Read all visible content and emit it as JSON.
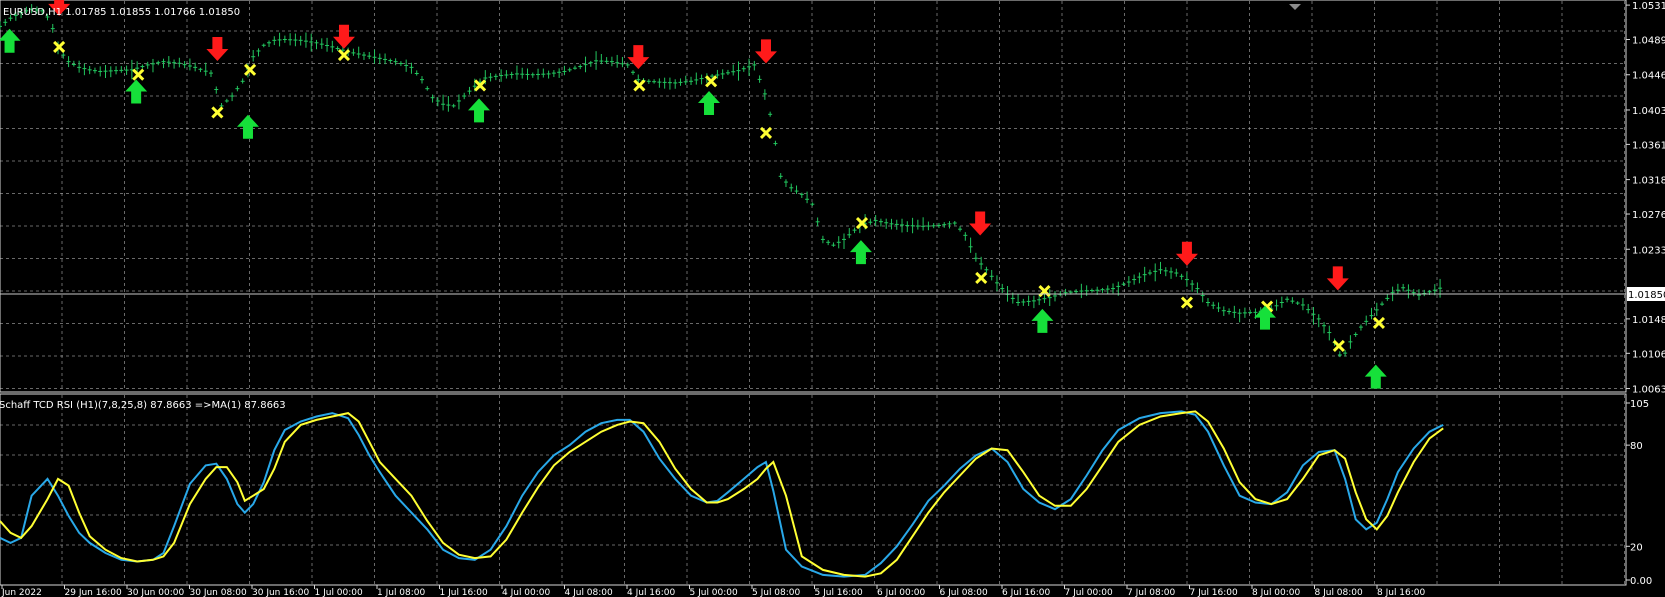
{
  "colors": {
    "background": "#000000",
    "grid": "#c0c0c0",
    "frame": "#d8d8d8",
    "candles": "#22c55e",
    "buy_arrow": "#16e03a",
    "sell_arrow": "#ff1a1a",
    "cross": "#ffff33",
    "schaff_line": "#29a8e8",
    "signal_line": "#ffff33",
    "text": "#ffffff",
    "price_label_bg": "#ffffff",
    "price_label_text": "#000000"
  },
  "main_panel": {
    "title": "EURUSD,H1  1.01785 1.01855 1.01766 1.01850",
    "price_axis": [
      "1.05310",
      "1.04890",
      "1.04460",
      "1.04030",
      "1.03610",
      "1.03180",
      "1.02760",
      "1.02330",
      "1.01850",
      "1.01480",
      "1.01060",
      "1.00630"
    ],
    "current_price": "1.01850"
  },
  "indicator_panel": {
    "title": "Schaff TCD RSI (H1)(7,8,25,8) 87.8663  =>MA(1) 87.8663",
    "axis_labels": [
      "105",
      "80",
      "20",
      "0.00"
    ]
  },
  "time_axis": [
    "Jun 2022",
    "29 Jun 16:00",
    "30 Jun 00:00",
    "30 Jun 08:00",
    "30 Jun 16:00",
    "1 Jul 00:00",
    "1 Jul 08:00",
    "1 Jul 16:00",
    "4 Jul 00:00",
    "4 Jul 08:00",
    "4 Jul 16:00",
    "5 Jul 00:00",
    "5 Jul 08:00",
    "5 Jul 16:00",
    "6 Jul 00:00",
    "6 Jul 08:00",
    "6 Jul 16:00",
    "7 Jul 00:00",
    "7 Jul 08:00",
    "7 Jul 16:00",
    "8 Jul 00:00",
    "8 Jul 08:00",
    "8 Jul 16:00"
  ],
  "chart_data": {
    "type": "line",
    "title": "EURUSD,H1",
    "price_series": {
      "name": "EURUSD,H1",
      "x": [
        0,
        10,
        20,
        30,
        40,
        48,
        55,
        65,
        75,
        85,
        95,
        110,
        125,
        140,
        155,
        170,
        185,
        200,
        210,
        220,
        230,
        240,
        250,
        260,
        270,
        285,
        300,
        315,
        330,
        345,
        360,
        375,
        390,
        400,
        410,
        420,
        430,
        440,
        450,
        460,
        475,
        490,
        505,
        520,
        535,
        550,
        565,
        580,
        595,
        605,
        615,
        625,
        640,
        655,
        670,
        685,
        700,
        715,
        728,
        735,
        740,
        750,
        760,
        770,
        780,
        790,
        800,
        815,
        830,
        845,
        860,
        875,
        890,
        905,
        915,
        925,
        935,
        945,
        955,
        965,
        980,
        995,
        1010,
        1025,
        1040,
        1055,
        1070,
        1085,
        1100,
        1115,
        1125,
        1135,
        1145,
        1160,
        1175,
        1190,
        1205,
        1220,
        1235,
        1250,
        1262,
        1272,
        1280,
        1290,
        1300,
        1310,
        1320,
        1330,
        1345,
        1360,
        1368
      ],
      "y": [
        1.0505,
        1.0515,
        1.0522,
        1.0526,
        1.0524,
        1.0512,
        1.0478,
        1.0462,
        1.0455,
        1.0452,
        1.045,
        1.0451,
        1.0452,
        1.0458,
        1.0462,
        1.046,
        1.0455,
        1.0448,
        1.0408,
        1.042,
        1.0438,
        1.0468,
        1.0482,
        1.0488,
        1.0489,
        1.0488,
        1.0485,
        1.048,
        1.0474,
        1.047,
        1.0466,
        1.0462,
        1.0455,
        1.044,
        1.0418,
        1.041,
        1.0408,
        1.042,
        1.0432,
        1.0442,
        1.0445,
        1.0447,
        1.0446,
        1.0447,
        1.045,
        1.0456,
        1.0463,
        1.0462,
        1.0458,
        1.044,
        1.0438,
        1.0437,
        1.0436,
        1.0438,
        1.0443,
        1.0447,
        1.0451,
        1.0458,
        1.0412,
        1.0362,
        1.0322,
        1.0308,
        1.03,
        1.0288,
        1.0245,
        1.0238,
        1.0245,
        1.0262,
        1.0268,
        1.0264,
        1.0262,
        1.0261,
        1.0262,
        1.0265,
        1.025,
        1.0222,
        1.0208,
        1.0192,
        1.0178,
        1.0168,
        1.017,
        1.0174,
        1.018,
        1.0182,
        1.0183,
        1.0185,
        1.0193,
        1.0202,
        1.0208,
        1.0204,
        1.0196,
        1.0185,
        1.0168,
        1.0158,
        1.0155,
        1.0156,
        1.016,
        1.0172,
        1.0165,
        1.0148,
        1.0128,
        1.0098,
        1.012,
        1.0138,
        1.0152,
        1.0166,
        1.018,
        1.0186,
        1.0177,
        1.0183,
        1.0187
      ]
    },
    "signals": [
      {
        "type": "sell",
        "x": 57,
        "price": 1.053
      },
      {
        "type": "buy",
        "x": 10,
        "price": 1.049
      },
      {
        "type": "cross",
        "x": 57,
        "price": 1.048
      },
      {
        "type": "cross",
        "x": 132,
        "price": 1.0446
      },
      {
        "type": "buy",
        "x": 130,
        "price": 1.0428
      },
      {
        "type": "sell",
        "x": 207,
        "price": 1.0475
      },
      {
        "type": "cross",
        "x": 207,
        "price": 1.04
      },
      {
        "type": "cross",
        "x": 238,
        "price": 1.0452
      },
      {
        "type": "buy",
        "x": 236,
        "price": 1.0385
      },
      {
        "type": "sell",
        "x": 327,
        "price": 1.049
      },
      {
        "type": "cross",
        "x": 327,
        "price": 1.047
      },
      {
        "type": "cross",
        "x": 456,
        "price": 1.0433
      },
      {
        "type": "buy",
        "x": 455,
        "price": 1.0405
      },
      {
        "type": "sell",
        "x": 606,
        "price": 1.0465
      },
      {
        "type": "cross",
        "x": 607,
        "price": 1.0433
      },
      {
        "type": "cross",
        "x": 675,
        "price": 1.0438
      },
      {
        "type": "buy",
        "x": 673,
        "price": 1.0414
      },
      {
        "type": "sell",
        "x": 727,
        "price": 1.0472
      },
      {
        "type": "cross",
        "x": 727,
        "price": 1.0375
      },
      {
        "type": "cross",
        "x": 818,
        "price": 1.0265
      },
      {
        "type": "buy",
        "x": 817,
        "price": 1.0232
      },
      {
        "type": "sell",
        "x": 930,
        "price": 1.0262
      },
      {
        "type": "cross",
        "x": 931,
        "price": 1.0198
      },
      {
        "type": "cross",
        "x": 991,
        "price": 1.0182
      },
      {
        "type": "buy",
        "x": 989,
        "price": 1.0148
      },
      {
        "type": "sell",
        "x": 1126,
        "price": 1.0225
      },
      {
        "type": "cross",
        "x": 1126,
        "price": 1.0168
      },
      {
        "type": "cross",
        "x": 1202,
        "price": 1.0163
      },
      {
        "type": "buy",
        "x": 1200,
        "price": 1.0152
      },
      {
        "type": "sell",
        "x": 1269,
        "price": 1.0195
      },
      {
        "type": "cross",
        "x": 1270,
        "price": 1.0115
      },
      {
        "type": "cross",
        "x": 1308,
        "price": 1.0143
      },
      {
        "type": "buy",
        "x": 1305,
        "price": 1.008
      }
    ],
    "indicator": {
      "name": "Schaff TCD RSI (H1)(7,8,25,8)",
      "ylim": [
        0,
        105
      ],
      "schaff": {
        "x": [
          0,
          10,
          20,
          30,
          45,
          55,
          65,
          75,
          85,
          100,
          115,
          130,
          145,
          155,
          165,
          180,
          195,
          205,
          215,
          225,
          232,
          240,
          250,
          260,
          270,
          285,
          300,
          315,
          330,
          340,
          350,
          360,
          375,
          390,
          405,
          420,
          435,
          450,
          465,
          480,
          495,
          510,
          525,
          540,
          555,
          570,
          585,
          597,
          610,
          625,
          640,
          655,
          670,
          680,
          690,
          705,
          718,
          726,
          733,
          745,
          760,
          780,
          800,
          820,
          835,
          850,
          865,
          880,
          895,
          910,
          925,
          940,
          955,
          970,
          985,
          1000,
          1015,
          1030,
          1045,
          1060,
          1080,
          1100,
          1120,
          1133,
          1145,
          1160,
          1175,
          1190,
          1205,
          1220,
          1235,
          1250,
          1265,
          1275,
          1285,
          1295,
          1305,
          1315,
          1325,
          1340,
          1355,
          1368
        ],
        "y": [
          25,
          22,
          25,
          50,
          60,
          50,
          38,
          28,
          22,
          16,
          12,
          11,
          12,
          16,
          32,
          57,
          68,
          69,
          60,
          45,
          40,
          45,
          58,
          77,
          89,
          94,
          97,
          99,
          96,
          86,
          74,
          64,
          50,
          40,
          30,
          18,
          13,
          12,
          18,
          32,
          50,
          64,
          74,
          80,
          88,
          93,
          95,
          95,
          88,
          72,
          60,
          50,
          46,
          47,
          52,
          60,
          67,
          70,
          53,
          18,
          8,
          3,
          2,
          3,
          10,
          20,
          33,
          47,
          56,
          66,
          74,
          78,
          70,
          54,
          46,
          42,
          48,
          62,
          77,
          89,
          96,
          99,
          100,
          98,
          88,
          68,
          50,
          46,
          45,
          52,
          68,
          76,
          77,
          60,
          36,
          30,
          34,
          48,
          64,
          78,
          88,
          92
        ]
      },
      "signal": {
        "x": [
          0,
          10,
          20,
          30,
          45,
          55,
          65,
          75,
          85,
          100,
          115,
          130,
          145,
          155,
          165,
          180,
          195,
          205,
          215,
          225,
          232,
          240,
          250,
          260,
          270,
          285,
          300,
          315,
          330,
          340,
          350,
          360,
          375,
          390,
          405,
          420,
          435,
          450,
          465,
          480,
          495,
          510,
          525,
          540,
          555,
          570,
          585,
          597,
          610,
          625,
          640,
          655,
          670,
          680,
          690,
          705,
          718,
          726,
          733,
          745,
          760,
          780,
          800,
          820,
          835,
          850,
          865,
          880,
          895,
          910,
          925,
          940,
          955,
          970,
          985,
          1000,
          1015,
          1030,
          1045,
          1060,
          1080,
          1100,
          1120,
          1133,
          1145,
          1160,
          1175,
          1190,
          1205,
          1220,
          1235,
          1250,
          1265,
          1275,
          1285,
          1295,
          1305,
          1315,
          1325,
          1340,
          1355,
          1368
        ],
        "y": [
          35,
          28,
          25,
          32,
          48,
          60,
          56,
          40,
          26,
          18,
          13,
          11,
          12,
          14,
          22,
          45,
          60,
          67,
          67,
          58,
          47,
          50,
          54,
          66,
          82,
          92,
          95,
          97,
          99,
          94,
          82,
          70,
          60,
          50,
          35,
          22,
          15,
          13,
          14,
          24,
          40,
          55,
          68,
          76,
          82,
          88,
          92,
          94,
          93,
          82,
          66,
          54,
          46,
          46,
          48,
          54,
          60,
          66,
          70,
          50,
          14,
          6,
          3,
          2,
          4,
          12,
          26,
          40,
          52,
          62,
          72,
          78,
          77,
          64,
          50,
          44,
          44,
          54,
          68,
          82,
          92,
          97,
          99,
          100,
          94,
          78,
          58,
          48,
          45,
          48,
          60,
          74,
          77,
          72,
          52,
          36,
          30,
          38,
          52,
          70,
          84,
          90
        ]
      }
    }
  }
}
